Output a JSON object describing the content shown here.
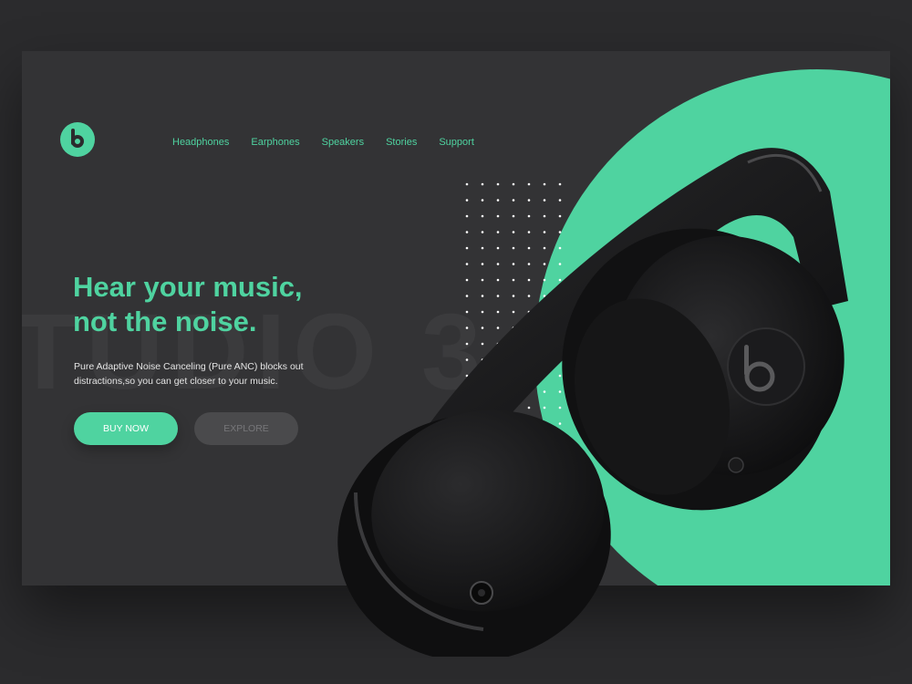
{
  "brand": {
    "logo_icon": "beats-logo-icon",
    "accent_color": "#4fd3a0",
    "background_color": "#2b2b2d"
  },
  "nav": {
    "items": [
      {
        "label": "Headphones"
      },
      {
        "label": "Earphones"
      },
      {
        "label": "Speakers"
      },
      {
        "label": "Stories"
      },
      {
        "label": "Support"
      }
    ]
  },
  "hero": {
    "headline_line1": "Hear your music,",
    "headline_line2": "not the noise.",
    "description": "Pure Adaptive Noise Canceling (Pure ANC) blocks out distractions,so you can get closer to your music.",
    "background_word": "TUDIO 3",
    "product_image": "beats-headphones-image"
  },
  "actions": {
    "buy_label": "BUY NOW",
    "explore_label": "EXPLORE"
  }
}
